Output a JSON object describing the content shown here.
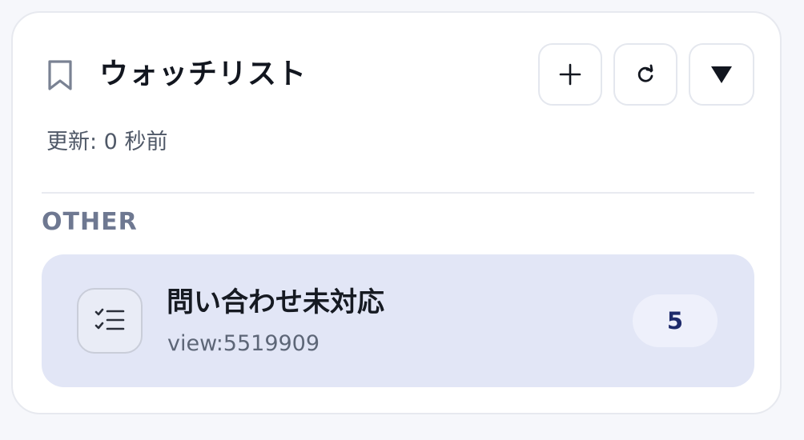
{
  "header": {
    "title": "ウォッチリスト",
    "add_icon": "plus-icon",
    "refresh_icon": "refresh-icon",
    "toggle_icon": "triangle-down-icon",
    "bookmark_icon": "bookmark-icon"
  },
  "status": {
    "updated_text": "更新: 0 秒前"
  },
  "sections": [
    {
      "label": "OTHER",
      "items": [
        {
          "title": "問い合わせ未対応",
          "subtitle": "view:5519909",
          "count": "5",
          "icon": "checklist-icon"
        }
      ]
    }
  ],
  "colors": {
    "item_background": "#e2e6f6",
    "badge_text": "#1d2a6b",
    "section_label": "#6e7891"
  }
}
